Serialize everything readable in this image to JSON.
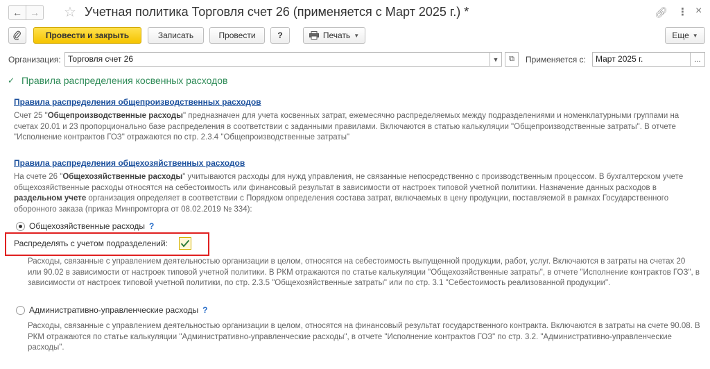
{
  "window": {
    "title": "Учетная политика Торговля счет 26 (применяется с Март 2025 г.) *"
  },
  "toolbar": {
    "post_close_label": "Провести и закрыть",
    "save_label": "Записать",
    "post_label": "Провести",
    "help_label": "?",
    "print_label": "Печать",
    "more_label": "Еще"
  },
  "form": {
    "organization_label": "Организация:",
    "organization_value": "Торговля счет 26",
    "applies_from_label": "Применяется с:",
    "applies_from_value": "Март 2025 г.",
    "applies_from_button": "..."
  },
  "section": {
    "title": "Правила распределения косвенных расходов",
    "overhead": {
      "link": "Правила распределения общепроизводственных расходов",
      "text_pre": "Счет 25 \"",
      "text_bold": "Общепроизводственные расходы",
      "text_post": "\" предназначен для учета косвенных затрат, ежемесячно распределяемых между подразделениями и номенклатурными группами на счетах 20.01 и 23 пропорционально базе распределения в соответствии с заданными правилами. Включаются в статью калькуляции \"Общепроизводственные затраты\". В отчете \"Исполнение контрактов ГОЗ\" отражаются по стр. 2.3.4 \"Общепроизводственные затраты\""
    },
    "general": {
      "link": "Правила распределения общехозяйственных расходов",
      "text_1": "На счете 26 \"",
      "text_bold1": "Общехозяйственные расходы",
      "text_2": "\" учитываются расходы для нужд управления, не связанные непосредственно с производственным процессом. В бухгалтерском учете общехозяйственные расходы относятся на себестоимость или финансовый результат в зависимости от настроек типовой учетной политики. Назначение данных расходов в ",
      "text_bold2": "раздельном учете",
      "text_3": " организация определяет в соответствии с Порядком определения состава затрат, включаемых в цену продукции, поставляемой в рамках Государственного оборонного заказа (приказ Минпромторга от 08.02.2019 № 334):"
    },
    "option1": {
      "label": "Общехозяйственные расходы",
      "help": "?",
      "selected": true,
      "checkbox_label": "Распределять с учетом подразделений:",
      "checkbox_checked": true,
      "desc": "Расходы, связанные с управлением деятельностью организации в целом, относятся на себестоимость выпущенной продукции, работ, услуг. Включаются в затраты на счетах 20 или 90.02 в зависимости от настроек типовой учетной политики. В РКМ отражаются по статье калькуляции \"Общехозяйственные затраты\", в отчете \"Исполнение контрактов ГОЗ\", в зависимости от настроек типовой учетной политики, по стр. 2.3.5 \"Общехозяйственные затраты\" или по стр. 3.1 \"Себестоимость реализованной продукции\"."
    },
    "option2": {
      "label": "Административно-управленческие расходы",
      "help": "?",
      "selected": false,
      "desc": "Расходы, связанные с управлением деятельностью организации в целом, относятся на финансовый результат государственного контракта. Включаются в затраты на счете 90.08. В РКМ отражаются по статье калькуляции \"Административно-управленческие расходы\", в отчете \"Исполнение контрактов ГОЗ\"  по стр. 3.2. \"Административно-управленческие расходы\"."
    }
  }
}
